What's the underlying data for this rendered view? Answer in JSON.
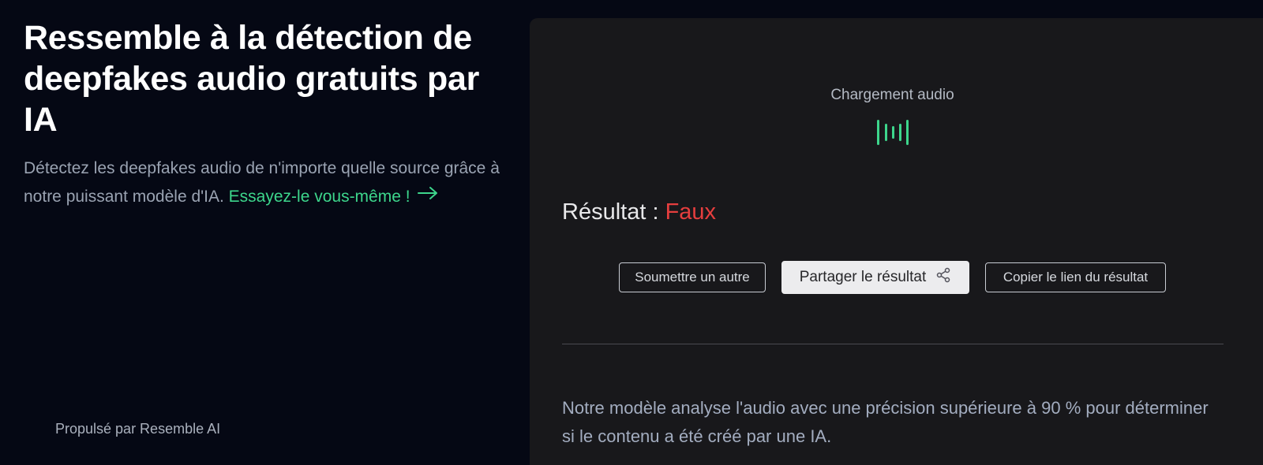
{
  "hero": {
    "title": "Ressemble à la détection de deepfakes audio gratuits par IA",
    "subtitle": "Détectez les deepfakes audio de n'importe quelle source grâce à notre puissant modèle d'IA.",
    "cta_label": "Essayez-le vous-même !",
    "cta_icon": "arrow-right-icon"
  },
  "footer": {
    "powered_by": "Propulsé par Resemble AI"
  },
  "panel": {
    "loading_label": "Chargement audio",
    "loading_icon": "audio-wave-icon",
    "result_label": "Résultat :",
    "result_value": "Faux",
    "buttons": {
      "submit_another": "Soumettre un autre",
      "share_result": "Partager le résultat",
      "copy_link": "Copier le lien du résultat"
    },
    "description": "Notre modèle analyse l'audio avec une précision supérieure à 90 % pour déterminer si le contenu a été créé par une IA."
  },
  "colors": {
    "background": "#050814",
    "panel": "#18181b",
    "accent_green": "#3dd68c",
    "result_fake": "#e53e3e"
  }
}
